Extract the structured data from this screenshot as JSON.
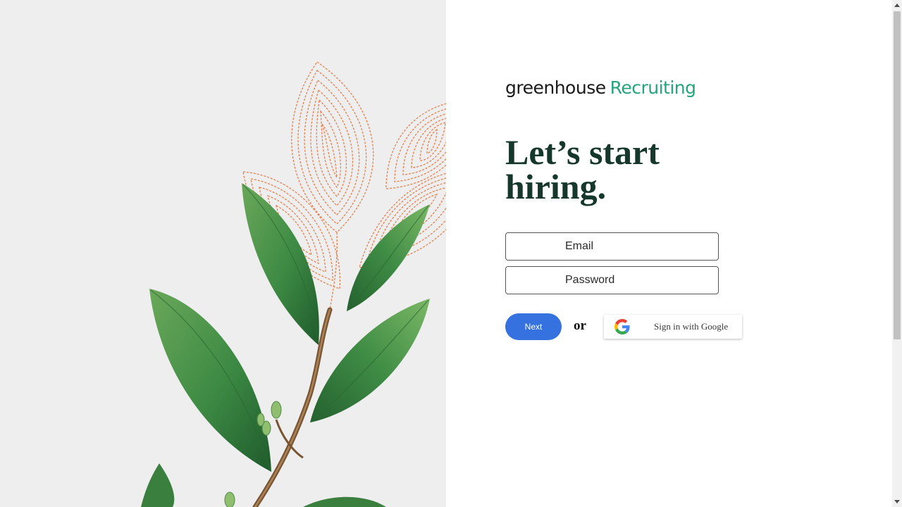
{
  "brand": {
    "name": "greenhouse",
    "product": "Recruiting",
    "accent_color": "#24a47f"
  },
  "headline": "Let’s start hiring.",
  "form": {
    "email_placeholder": "Email",
    "password_placeholder": "Password",
    "next_label": "Next",
    "or_label": "or",
    "google_label": "Sign in with Google"
  },
  "colors": {
    "panel_background": "#eeeeee",
    "headline": "#15372c",
    "next_button": "#3572e0",
    "illustration_orange": "#e8743b",
    "illustration_leaf_green": "#3d8a44"
  },
  "icons": {
    "google": "google-g-logo-icon"
  }
}
